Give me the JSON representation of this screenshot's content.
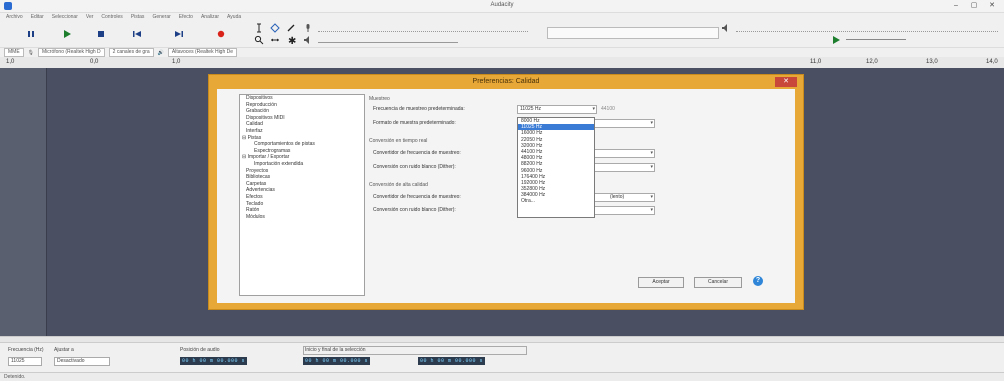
{
  "window": {
    "title": "Audacity",
    "min": "–",
    "max": "▢",
    "close": "✕"
  },
  "menu": [
    "Archivo",
    "Editar",
    "Seleccionar",
    "Ver",
    "Controles",
    "Pistas",
    "Generar",
    "Efecto",
    "Analizar",
    "Ayuda"
  ],
  "devices": {
    "host": "MME",
    "mic": "Micrófono (Realtek High D",
    "channels": "2 canales de gra",
    "speaker": "Altavoces (Realtek High De"
  },
  "ruler": {
    "ticks": [
      "1,0",
      "0,0",
      "1,0",
      "11,0",
      "12,0",
      "13,0",
      "14,0"
    ]
  },
  "dialog": {
    "title": "Preferencias: Calidad",
    "close": "✕",
    "tree": [
      "Dispositivos",
      "Reproducción",
      "Grabación",
      "Dispositivos MIDI",
      "Calidad",
      "Interfaz",
      "Pistas",
      "Comportamientos de pistas",
      "Espectrogramas",
      "Importar / Exportar",
      "Importación extendida",
      "Proyectos",
      "Bibliotecas",
      "Carpetas",
      "Advertencias",
      "Efectos",
      "Teclado",
      "Ratón",
      "Módulos"
    ],
    "section_sampling": "Muestreo",
    "default_rate_label": "Frecuencia de muestreo predeterminada:",
    "default_rate_value": "11025 Hz",
    "default_rate_extra": "44100",
    "sample_format_label": "Formato de muestra predeterminado:",
    "section_realtime": "Conversión en tiempo real",
    "rt_rate_label": "Convertidor de frecuencia de muestreo:",
    "rt_dither_label": "Conversión con ruido blanco (Dither):",
    "section_hq": "Conversión de alta calidad",
    "hq_rate_label": "Convertidor de frecuencia de muestreo:",
    "hq_rate_extra": "(lento)",
    "hq_dither_label": "Conversión con ruido blanco (Dither):",
    "accept": "Aceptar",
    "cancel": "Cancelar",
    "help": "?"
  },
  "dropdown": {
    "selected_index": 1,
    "options": [
      "8000 Hz",
      "11025 Hz",
      "16000 Hz",
      "22050 Hz",
      "32000 Hz",
      "44100 Hz",
      "48000 Hz",
      "88200 Hz",
      "96000 Hz",
      "176400 Hz",
      "192000 Hz",
      "352800 Hz",
      "384000 Hz",
      "Otra..."
    ]
  },
  "selection": {
    "rate_label": "Frecuencia (Hz)",
    "rate_value": "11025",
    "snap_label": "Ajustar a",
    "snap_value": "Desactivado",
    "pos_label": "Posición de audio",
    "pos_value": "00 h 00 m 00.000 s",
    "sel_label": "Inicio y final de la selección",
    "sel_start": "00 h 00 m 00.000 s",
    "sel_end": "00 h 00 m 00.000 s"
  },
  "status": "Detenido."
}
